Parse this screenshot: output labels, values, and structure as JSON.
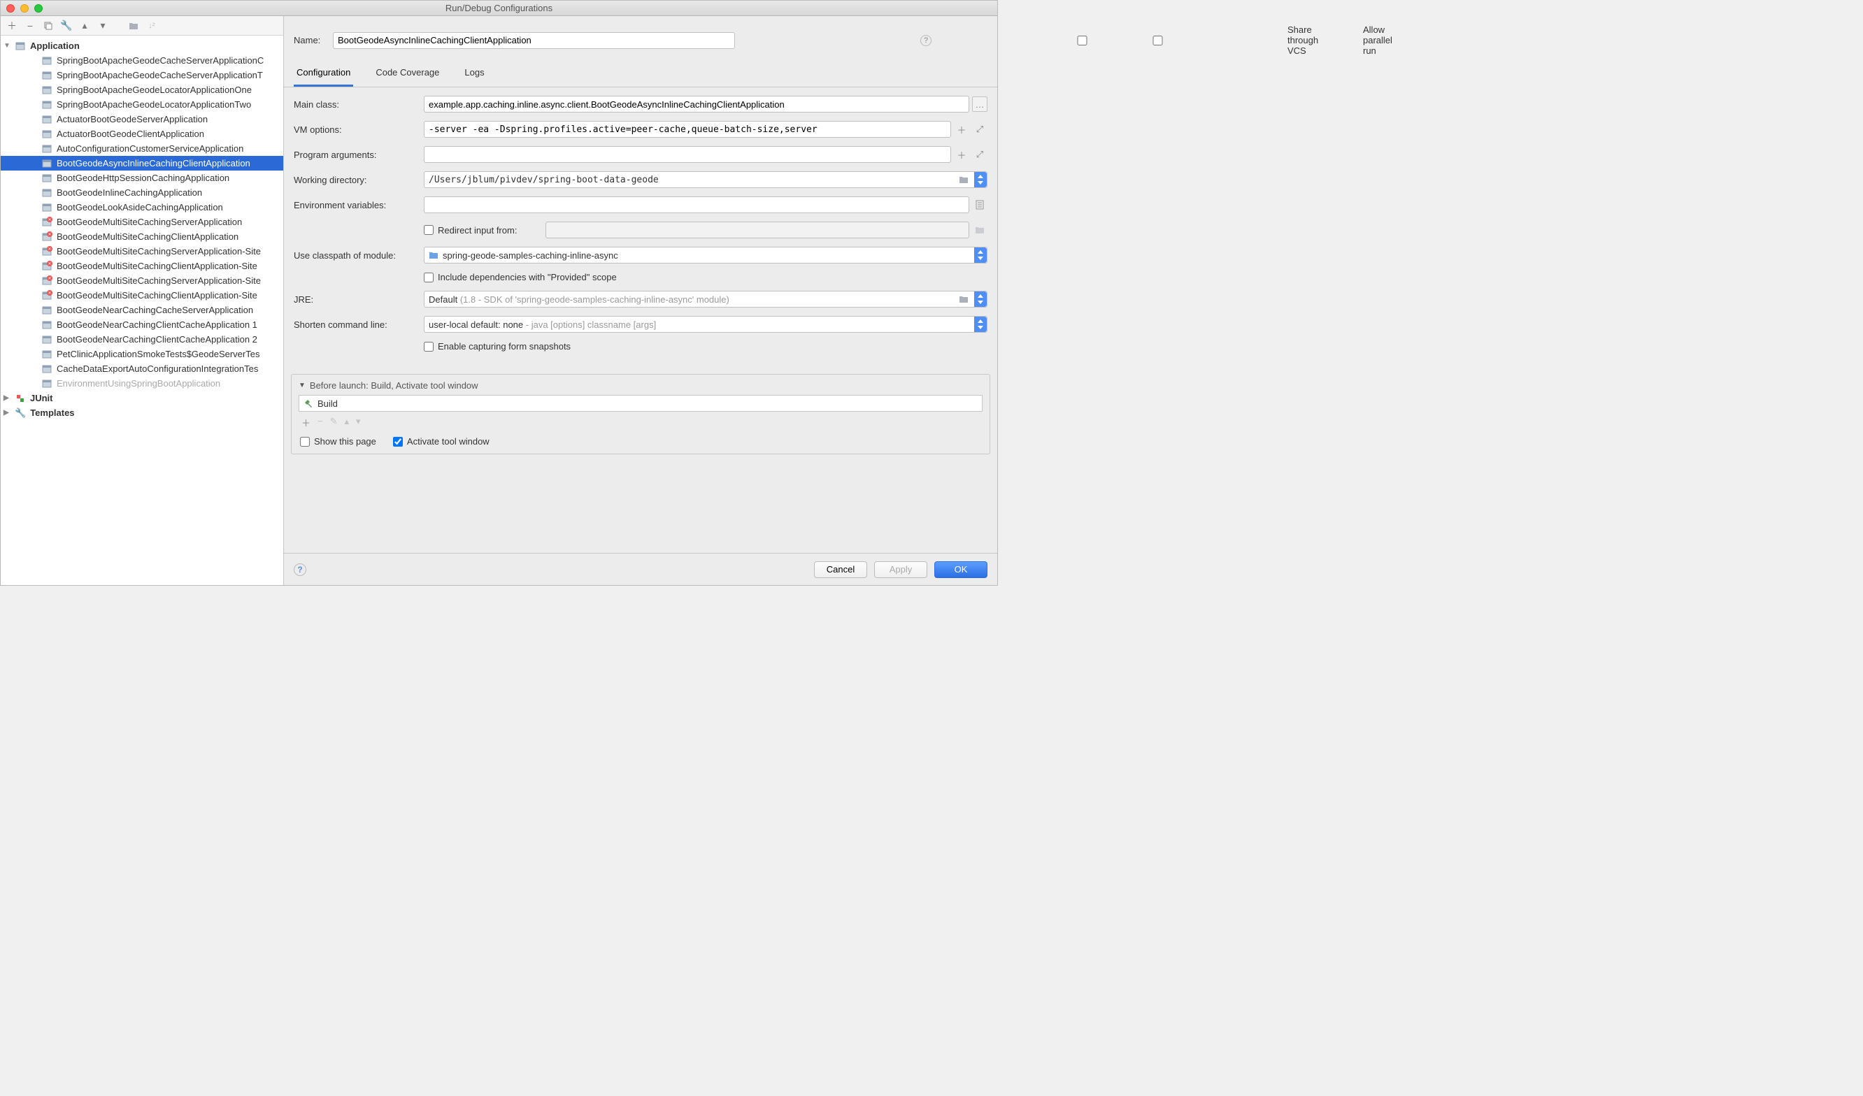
{
  "window": {
    "title": "Run/Debug Configurations"
  },
  "header": {
    "name_label": "Name:",
    "name_value": "BootGeodeAsyncInlineCachingClientApplication",
    "share_label": "Share through VCS",
    "parallel_label": "Allow parallel run"
  },
  "tabs": {
    "config": "Configuration",
    "coverage": "Code Coverage",
    "logs": "Logs"
  },
  "tree": {
    "application_label": "Application",
    "junit_label": "JUnit",
    "templates_label": "Templates",
    "items": [
      {
        "label": "SpringBootApacheGeodeCacheServerApplicationC"
      },
      {
        "label": "SpringBootApacheGeodeCacheServerApplicationT"
      },
      {
        "label": "SpringBootApacheGeodeLocatorApplicationOne"
      },
      {
        "label": "SpringBootApacheGeodeLocatorApplicationTwo"
      },
      {
        "label": "ActuatorBootGeodeServerApplication"
      },
      {
        "label": "ActuatorBootGeodeClientApplication"
      },
      {
        "label": "AutoConfigurationCustomerServiceApplication"
      },
      {
        "label": "BootGeodeAsyncInlineCachingClientApplication",
        "selected": true
      },
      {
        "label": "BootGeodeHttpSessionCachingApplication"
      },
      {
        "label": "BootGeodeInlineCachingApplication"
      },
      {
        "label": "BootGeodeLookAsideCachingApplication"
      },
      {
        "label": "BootGeodeMultiSiteCachingServerApplication",
        "err": true
      },
      {
        "label": "BootGeodeMultiSiteCachingClientApplication",
        "err": true
      },
      {
        "label": "BootGeodeMultiSiteCachingServerApplication-Site",
        "err": true
      },
      {
        "label": "BootGeodeMultiSiteCachingClientApplication-Site",
        "err": true
      },
      {
        "label": "BootGeodeMultiSiteCachingServerApplication-Site",
        "err": true
      },
      {
        "label": "BootGeodeMultiSiteCachingClientApplication-Site",
        "err": true
      },
      {
        "label": "BootGeodeNearCachingCacheServerApplication"
      },
      {
        "label": "BootGeodeNearCachingClientCacheApplication 1"
      },
      {
        "label": "BootGeodeNearCachingClientCacheApplication 2"
      },
      {
        "label": "PetClinicApplicationSmokeTests$GeodeServerTes"
      },
      {
        "label": "CacheDataExportAutoConfigurationIntegrationTes"
      },
      {
        "label": "EnvironmentUsingSpringBootApplication",
        "dim": true
      }
    ]
  },
  "form": {
    "main_class_label": "Main class:",
    "main_class": "example.app.caching.inline.async.client.BootGeodeAsyncInlineCachingClientApplication",
    "vm_label": "VM options:",
    "vm_value": "-server -ea -Dspring.profiles.active=peer-cache,queue-batch-size,server",
    "args_label": "Program arguments:",
    "args_value": "",
    "wd_label": "Working directory:",
    "wd_value": "/Users/jblum/pivdev/spring-boot-data-geode",
    "env_label": "Environment variables:",
    "env_value": "",
    "redirect_label": "Redirect input from:",
    "cp_label": "Use classpath of module:",
    "cp_value": "spring-geode-samples-caching-inline-async",
    "provided_label": "Include dependencies with \"Provided\" scope",
    "jre_label": "JRE:",
    "jre_value_prefix": "Default ",
    "jre_value_gray": "(1.8 - SDK of 'spring-geode-samples-caching-inline-async' module)",
    "shorten_label": "Shorten command line:",
    "shorten_value_prefix": "user-local default: none ",
    "shorten_value_gray": "- java [options] classname [args]",
    "snapshots_label": "Enable capturing form snapshots"
  },
  "before": {
    "title": "Before launch: Build, Activate tool window",
    "build": "Build",
    "show_page": "Show this page",
    "activate": "Activate tool window"
  },
  "footer": {
    "cancel": "Cancel",
    "apply": "Apply",
    "ok": "OK"
  }
}
